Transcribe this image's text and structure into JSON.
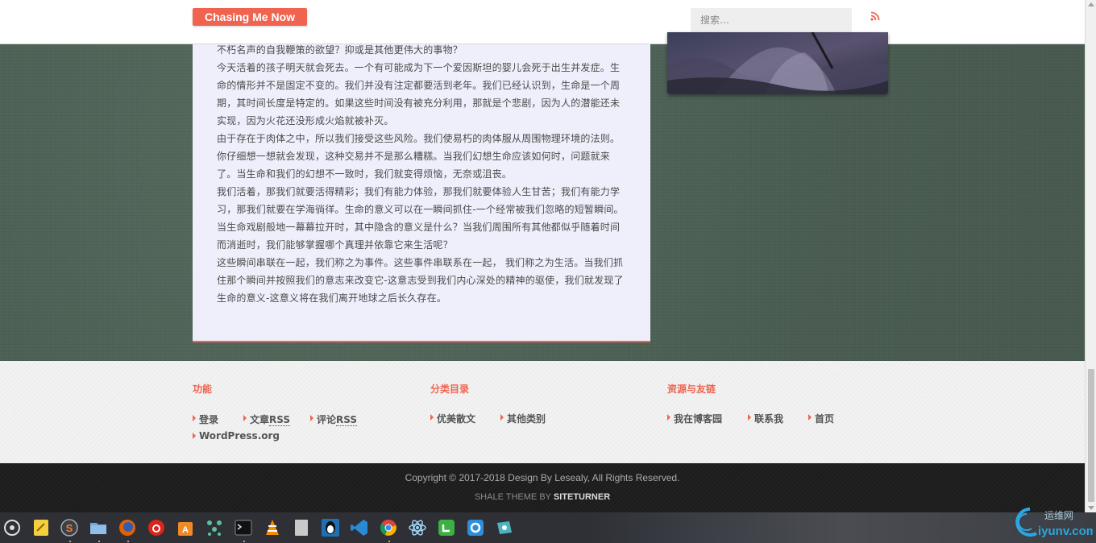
{
  "header": {
    "site_title": "Chasing Me Now",
    "search_placeholder": "搜索…"
  },
  "article": {
    "paragraphs": [
      "不朽名声的自我鞭策的欲望？抑或是其他更伟大的事物？",
      "今天活着的孩子明天就会死去。一个有可能成为下一个爱因斯坦的婴儿会死于出生并发症。生命的情形并不是固定不变的。我们并没有注定都要活到老年。我们已经认识到，生命是一个周期，其时间长度是特定的。如果这些时间没有被充分利用，那就是个悲剧，因为人的潜能还未实现，因为火花还没形成火焰就被补灭。",
      "由于存在于肉体之中，所以我们接受这些风险。我们使易朽的肉体服从周围物理环境的法则。你仔细想一想就会发现，这种交易并不是那么糟糕。当我们幻想生命应该如何时，问题就来了。当生命和我们的幻想不一致时，我们就变得烦恼，无奈或沮丧。",
      "我们活着，那我们就要活得精彩；我们有能力体验，那我们就要体验人生甘苦；我们有能力学习，那我们就要在学海徜徉。生命的意义可以在一瞬间抓住-一个经常被我们忽略的短暂瞬间。",
      "当生命戏剧般地一幕幕拉开时，其中隐含的意义是什么？当我们周围所有其他都似乎随着时间而消逝时，我们能够掌握哪个真理并依靠它来生活呢？",
      "这些瞬间串联在一起，我们称之为事件。这些事件串联系在一起， 我们称之为生活。当我们抓住那个瞬间并按照我们的意志来改变它-这意志受到我们内心深处的精神的驱使，我们就发现了生命的意义-这意义将在我们离开地球之后长久存在。"
    ]
  },
  "footer": {
    "widgets": [
      {
        "title": "功能",
        "links": [
          "登录",
          "文章",
          "评论",
          "WordPress.org"
        ],
        "abbr": "RSS"
      },
      {
        "title": "分类目录",
        "links": [
          "优美散文",
          "其他类别"
        ]
      },
      {
        "title": "资源与友链",
        "links": [
          "我在博客园",
          "联系我",
          "首页"
        ]
      }
    ],
    "copyright": "Copyright © 2017-2018 Design By Lesealy, All Rights Reserved.",
    "theme_prefix": "SHALE THEME BY",
    "theme_author": "SITETURNER"
  },
  "taskbar": {
    "apps": [
      "start-menu",
      "sticky-notes",
      "sogou-input",
      "file-manager",
      "firefox",
      "netease-music",
      "app-store",
      "network-app",
      "terminal",
      "vlc",
      "text-editor",
      "qq",
      "vscode",
      "chrome",
      "atom",
      "wechat-dev",
      "qq-browser",
      "deepin-screenshot"
    ]
  },
  "watermark": {
    "text": "iyunv.com",
    "subtitle": "运维网"
  },
  "colors": {
    "accent": "#f0644f",
    "card_bg": "#efeffc",
    "page_bg": "#4e6256",
    "footer_bg": "#1d1d1d"
  }
}
